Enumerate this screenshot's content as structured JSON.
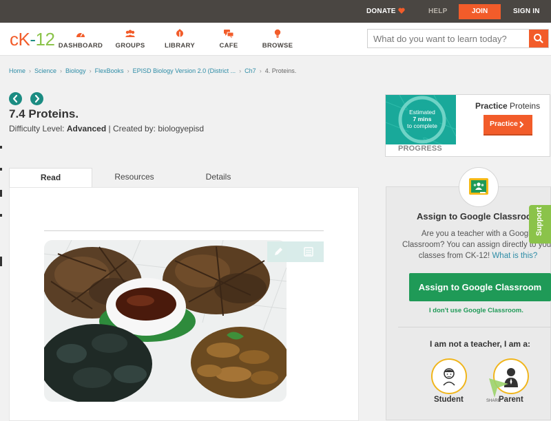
{
  "topbar": {
    "donate": "DONATE",
    "help": "HELP",
    "join": "JOIN",
    "sign_in": "SIGN IN"
  },
  "logo": {
    "ck": "cK",
    "dash": "-",
    "num": "12"
  },
  "nav": [
    {
      "label": "DASHBOARD",
      "icon": "dashboard-icon"
    },
    {
      "label": "GROUPS",
      "icon": "groups-icon"
    },
    {
      "label": "LIBRARY",
      "icon": "library-icon"
    },
    {
      "label": "CAFE",
      "icon": "cafe-icon"
    },
    {
      "label": "BROWSE",
      "icon": "browse-icon"
    }
  ],
  "search": {
    "placeholder": "What do you want to learn today?"
  },
  "breadcrumb": [
    "Home",
    "Science",
    "Biology",
    "FlexBooks",
    "EPISD Biology Version 2.0 (District ...",
    "Ch7",
    "4. Proteins."
  ],
  "article": {
    "title": "7.4 Proteins.",
    "difficulty_label": "Difficulty Level:",
    "difficulty_value": "Advanced",
    "created_by": "| Created by: biologyepisd"
  },
  "tabs": [
    "Read",
    "Resources",
    "Details"
  ],
  "practice": {
    "estimated": "Estimated",
    "mins": "7 mins",
    "to_complete": "to complete",
    "progress": "PROGRESS",
    "title_prefix": "Practice",
    "title_topic": "Proteins",
    "button": "Practice"
  },
  "assign": {
    "title": "Assign to Google Classroom",
    "line1": "Are you a teacher with a Google",
    "line2": "Classroom? You can assign directly to your",
    "line3": "classes from CK-12!",
    "link": "What is this?",
    "button": "Assign to Google Classroom",
    "no_use": "I don't use Google Classroom.",
    "not_teacher": "I am not a teacher, I am a:",
    "student": "Student",
    "parent": "Parent"
  },
  "support": "Support",
  "share": "SHARE",
  "colors": {
    "accent_orange": "#f25c2a",
    "teal": "#1b8c82",
    "green": "#1f9a57",
    "topbar": "#4a4642"
  }
}
